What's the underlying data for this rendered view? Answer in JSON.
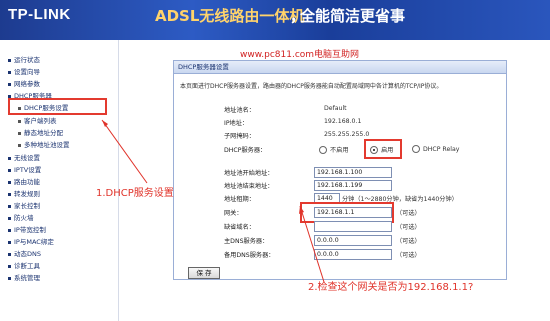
{
  "header": {
    "logo": "TP-LINK",
    "slogan_left": "ADSL无线路由一体机",
    "slogan_sep": "，",
    "slogan_right": "全能简洁更省事",
    "colors": {
      "bar": "#2d5bc4",
      "logo": "#ffffff",
      "slogan": "#ffd36b"
    }
  },
  "watermark": "www.pc811.com电脑互助网",
  "sidebar": {
    "items": [
      {
        "label": "运行状态",
        "level": 0
      },
      {
        "label": "设置向导",
        "level": 0
      },
      {
        "label": "网络参数",
        "level": 0
      },
      {
        "label": "DHCP服务器",
        "level": 0
      },
      {
        "label": "DHCP服务设置",
        "level": 1
      },
      {
        "label": "客户端列表",
        "level": 1
      },
      {
        "label": "静态地址分配",
        "level": 1
      },
      {
        "label": "多种地址池设置",
        "level": 1
      },
      {
        "label": "无线设置",
        "level": 0
      },
      {
        "label": "IPTV设置",
        "level": 0
      },
      {
        "label": "路由功能",
        "level": 0
      },
      {
        "label": "转发规则",
        "level": 0
      },
      {
        "label": "家长控制",
        "level": 0
      },
      {
        "label": "防火墙",
        "level": 0
      },
      {
        "label": "IP带宽控制",
        "level": 0
      },
      {
        "label": "IP与MAC绑定",
        "level": 0
      },
      {
        "label": "动态DNS",
        "level": 0
      },
      {
        "label": "诊断工具",
        "level": 0
      },
      {
        "label": "系统管理",
        "level": 0
      }
    ]
  },
  "panel": {
    "title": "DHCP服务器设置",
    "description": "本页面进行DHCP服务器设置，路由器的DHCP服务器能自动配置局域网中各计算机的TCP/IP协议。",
    "pool_name": {
      "label": "地址池名：",
      "value": "Default"
    },
    "ip": {
      "label": "IP地址：",
      "value": "192.168.0.1"
    },
    "mask": {
      "label": "子网掩码：",
      "value": "255.255.255.0"
    },
    "dhcp": {
      "label": "DHCP服务器：",
      "options": [
        "不启用",
        "启用",
        "DHCP Relay"
      ],
      "selected": "启用"
    },
    "start": {
      "label": "地址池开始地址：",
      "value": "192.168.1.100"
    },
    "end": {
      "label": "地址池结束地址：",
      "value": "192.168.1.199"
    },
    "lease": {
      "label": "地址租期：",
      "value": "1440",
      "hint": "分钟（1～2880分钟，缺省为1440分钟）"
    },
    "gateway": {
      "label": "网关：",
      "value": "192.168.1.1",
      "hint": "（可选）"
    },
    "domain": {
      "label": "缺省域名：",
      "value": "",
      "hint": "（可选）"
    },
    "dns1": {
      "label": "主DNS服务器：",
      "value": "0.0.0.0",
      "hint": "（可选）"
    },
    "dns2": {
      "label": "备用DNS服务器：",
      "value": "0.0.0.0",
      "hint": "（可选）"
    },
    "save_label": "保 存"
  },
  "annotations": {
    "step1": "1.DHCP服务设置",
    "step2": "2.检查这个网关是否为192.168.1.1?",
    "color": "#e0332a"
  }
}
